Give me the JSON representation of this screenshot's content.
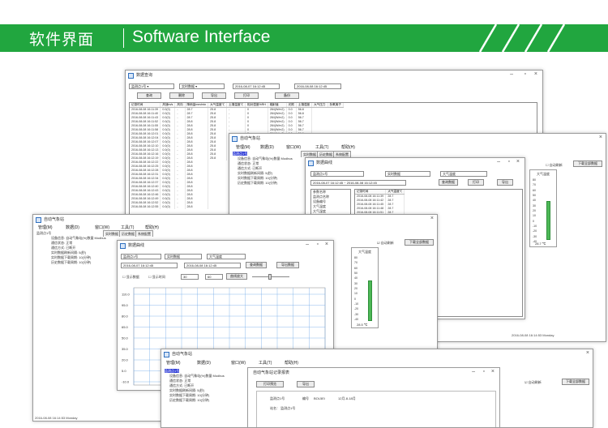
{
  "banner": {
    "title_cn": "软件界面",
    "title_en": "Software Interface"
  },
  "win_data_query": {
    "title": "数据查询",
    "station": "监测点1号",
    "data_type": "实时数据",
    "start_time": "2016-08-07 16:12:45",
    "end_time": "2016-08-08 16:12:45",
    "btn_query": "查询",
    "btn_delete": "删除",
    "btn_export": "导出",
    "btn_print": "打印",
    "btn_backup": "备份",
    "columns": [
      "记录时间",
      "风速m/s",
      "风向",
      "降雨量mm/min",
      "大气温度℃",
      "土壤温度℃",
      "相对湿度%RH",
      "辐射值",
      "光照",
      "土壤湿度",
      "大气压力",
      "负氧离子"
    ],
    "rows": [
      [
        "2016-08-08 16:11:39",
        "0.0(0)",
        "-",
        "28.7",
        "25.8",
        "-",
        "0",
        "284(W/m2)",
        "0.0",
        "56.8"
      ],
      [
        "2016-08-08 16:11:40",
        "0.0(0)",
        "-",
        "28.7",
        "25.8",
        "-",
        "0",
        "284(W/m2)",
        "0.0",
        "56.8"
      ],
      [
        "2016-08-08 16:11:43",
        "0.0(0)",
        "-",
        "28.7",
        "25.8",
        "-",
        "0",
        "284(W/m2)",
        "0.0",
        "56.7"
      ],
      [
        "2016-08-08 16:11:52",
        "0.0(0)",
        "-",
        "28.8",
        "25.8",
        "-",
        "0",
        "284(W/m2)",
        "0.0",
        "56.7"
      ],
      [
        "2016-08-08 16:11:55",
        "0.0(0)",
        "-",
        "28.8",
        "25.8",
        "-",
        "0",
        "284(W/m2)",
        "0.0",
        "56.7"
      ],
      [
        "2016-08-08 16:11:58",
        "0.0(0)",
        "-",
        "28.8",
        "25.8",
        "-",
        "0",
        "284(W/m2)",
        "0.0",
        "56.7"
      ],
      [
        "2016-08-08 16:12:01",
        "0.0(0)",
        "-",
        "28.8",
        "25.8",
        "-",
        "0",
        "284(W/m2)",
        "0.0",
        "56.6"
      ],
      [
        "2016-08-08 16:12:04",
        "0.0(0)",
        "-",
        "28.8",
        "25.8",
        "-",
        "0",
        "284(W/m2)",
        "0.0",
        "56.6"
      ],
      [
        "2016-08-08 16:12:07",
        "0.0(0)",
        "-",
        "28.8",
        "25.8",
        "-"
      ],
      [
        "2016-08-08 16:12:10",
        "0.0(0)",
        "-",
        "28.8",
        "25.8",
        "-"
      ],
      [
        "2016-08-08 16:12:13",
        "0.0(0)",
        "-",
        "28.8",
        "25.8",
        "-"
      ],
      [
        "2016-08-08 16:12:16",
        "0.0(0)",
        "-",
        "28.8",
        "25.8",
        "-"
      ],
      [
        "2016-08-08 16:12:19",
        "0.0(0)",
        "-",
        "28.8",
        "25.8",
        "-"
      ],
      [
        "2016-08-08 16:12:22",
        "0.0(0)",
        "-",
        "28.8"
      ],
      [
        "2016-08-08 16:12:25",
        "0.0(0)",
        "-",
        "28.8"
      ],
      [
        "2016-08-08 16:12:28",
        "0.0(0)",
        "-",
        "28.8"
      ],
      [
        "2016-08-08 16:12:31",
        "0.0(0)",
        "-",
        "28.8"
      ],
      [
        "2016-08-08 16:12:34",
        "0.0(0)",
        "-",
        "28.8"
      ],
      [
        "2016-08-08 16:12:37",
        "0.0(0)",
        "-",
        "28.8"
      ],
      [
        "2016-08-08 16:12:40",
        "0.0(0)",
        "-",
        "28.8"
      ],
      [
        "2016-08-08 16:12:43",
        "0.0(0)",
        "-",
        "28.8"
      ],
      [
        "2016-08-08 16:12:46",
        "0.0(0)",
        "-",
        "28.8"
      ],
      [
        "2016-08-08 16:12:49",
        "0.0(0)",
        "-",
        "28.8"
      ],
      [
        "2016-08-08 16:12:52",
        "0.0(0)",
        "-",
        "28.8"
      ],
      [
        "2016-08-08 16:12:55",
        "0.0(0)",
        "-",
        "28.8"
      ]
    ]
  },
  "win_main_right": {
    "title": "自动气象站",
    "menu": [
      "管理(M)",
      "数据(D)",
      "窗口(W)",
      "工具(T)",
      "帮助(H)"
    ],
    "tabs": [
      "实时数据",
      "历史数据",
      "系统配置"
    ],
    "tree": [
      "监测点1号",
      "设备信息: 自动气象站(%)数量 Modbus",
      "通信状态: 正常",
      "通信方式: 已断开",
      "实时数据刷新间隔: 5(秒)",
      "实时数据下载周期: 10(分钟)",
      "历史数据下载周期: 10(分钟)"
    ],
    "auto_refresh_label": "自动刷新",
    "btn_download": "下载全部数据",
    "gauge_title": "大气温度",
    "gauge_ticks": [
      "80",
      "70",
      "60",
      "50",
      "40",
      "30",
      "20",
      "10",
      "0",
      "-10",
      "-20",
      "-30",
      "-40"
    ],
    "gauge_value": "28.7 ℃",
    "datetime": "2016-08-08 16:14:53 Monday"
  },
  "win_curve_small": {
    "title": "数据曲线",
    "station": "监测点1号",
    "data_type": "实时数据",
    "factor": "大气温度",
    "start_time": "2016-08-07 16:12:45",
    "end_time": "2016-08-08 16:12:45",
    "btn_query": "查询数据",
    "btn_print": "打印",
    "btn_export": "导出",
    "list_header_a": "记录时间",
    "list_header_b": "大气温度℃",
    "list_times": [
      "2016-08-08 16:11:39",
      "2016-08-08 16:11:42",
      "2016-08-08 16:11:45",
      "2016-08-08 16:11:48",
      "2016-08-08 16:11:51",
      "2016-08-08 16:11:54",
      "2016-08-08 16:11:57",
      "2016-08-08 16:12:00",
      "2016-08-08 16:12:03",
      "2016-08-08 16:12:06"
    ],
    "list_values": [
      "28.7",
      "28.7",
      "28.7",
      "28.7",
      "28.7",
      "28.7",
      "28.7",
      "28.7",
      "28.7",
      "28.7"
    ],
    "left_list": [
      "参数名称",
      "监测点名称",
      "设备编号",
      "大气温度",
      "大气湿度",
      "风速风向"
    ]
  },
  "win_main_mid": {
    "title": "自动气象站",
    "menu": [
      "管理(M)",
      "数据(D)",
      "窗口(W)",
      "工具(T)",
      "帮助(H)"
    ],
    "tabs": [
      "实时数据",
      "历史数据",
      "系统配置"
    ],
    "tree": [
      "监测点1号",
      "设备信息: 自动气象站(%)数量 Modbus",
      "通信状态: 正常",
      "通信方式: 已断开",
      "实时数据刷新间隔: 5(秒)",
      "实时数据下载周期: 10(分钟)",
      "历史数据下载周期: 10(分钟)"
    ],
    "status": "2016-08-08 16:14:53 Monday",
    "gauge_title": "大气温度",
    "gauge_ticks": [
      "80",
      "70",
      "60",
      "50",
      "40",
      "30",
      "20",
      "10",
      "0",
      "-10",
      "-20",
      "-30",
      "-40"
    ],
    "gauge_value": "28.5 ℃",
    "auto_refresh_label": "自动刷新",
    "btn_download": "下载全部数据"
  },
  "win_curve_big": {
    "title": "数据曲线",
    "station": "监测点1号",
    "data_type": "实时数据",
    "factor": "大气温度",
    "start_time": "2016-08-07 16:12:45",
    "end_time": "2016-08-08 16:12:45",
    "btn_query": "查询数据",
    "btn_export": "导出数据",
    "show_points_label": "显示数据",
    "show_time_label": "显示时间",
    "interval_a": "30",
    "interval_b": "60",
    "btn_zoom": "曲线放大",
    "y_ticks": [
      "110.0",
      "95.0",
      "80.0",
      "65.0",
      "50.0",
      "35.0",
      "20.0",
      "5.0",
      "-10.0"
    ],
    "lower_y_ticks": [
      "25.0",
      "25.4"
    ],
    "bottom_labels": [
      "70.",
      "56.",
      "42.",
      "28."
    ]
  },
  "win_report": {
    "title": "自动气象站",
    "menu": [
      "管理(M)",
      "数据(D)",
      "窗口(W)",
      "工具(T)",
      "帮助(H)"
    ],
    "tree": [
      "监测点1号",
      "设备信息: 自动气象站(%)数量 Modbus",
      "通信状态: 正常",
      "通信方式: 已断开",
      "实时数据刷新间隔: 5(秒)",
      "实时数据下载周期: 10(分钟)",
      "历史数据下载周期: 10(分钟)"
    ],
    "auto_refresh_label": "自动刷新",
    "btn_download": "下载全部数据",
    "report_title": "自动气象站记录报表",
    "btn_print_preview": "打印预览",
    "btn_export": "导出",
    "label_station": "监测点1号",
    "label_id": "编号",
    "field_a": "站名：  监测点1号",
    "field_b": "记录时间：",
    "value_a": "BOL5Ei",
    "value_b": "12月-8-18月"
  }
}
